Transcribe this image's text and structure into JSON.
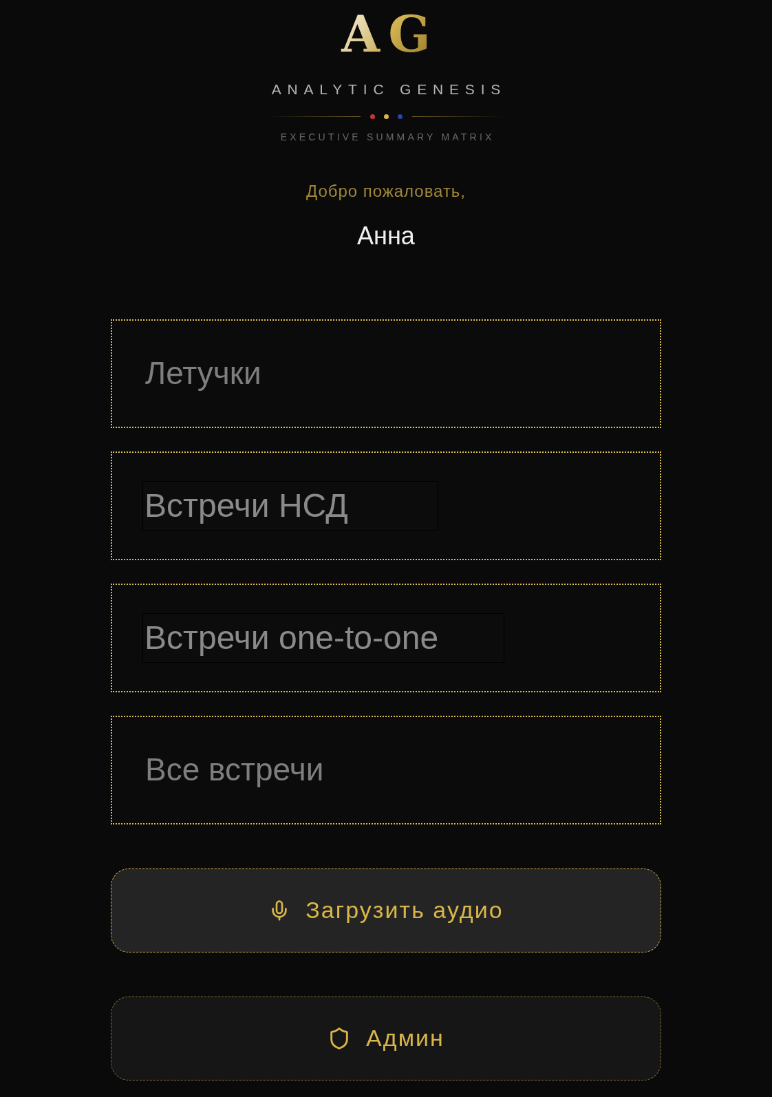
{
  "logo": {
    "letters": [
      "A",
      "G"
    ],
    "name": "ANALYTIC GENESIS",
    "tagline": "EXECUTIVE SUMMARY MATRIX",
    "dots": [
      {
        "color": "#c8323c"
      },
      {
        "color": "#d9b64a"
      },
      {
        "color": "#2a44a8"
      }
    ]
  },
  "greeting": {
    "text": "Добро пожаловать,",
    "user": "Анна"
  },
  "categories": [
    {
      "label": "Летучки",
      "kind": "plain"
    },
    {
      "label": "Встречи НСД",
      "kind": "framed"
    },
    {
      "label": "Встречи one-to-one",
      "kind": "framed"
    },
    {
      "label": "Все встречи",
      "kind": "plain"
    }
  ],
  "actions": [
    {
      "label": "Загрузить аудио",
      "kind": "upload"
    },
    {
      "label": "Админ",
      "kind": "admin"
    }
  ]
}
